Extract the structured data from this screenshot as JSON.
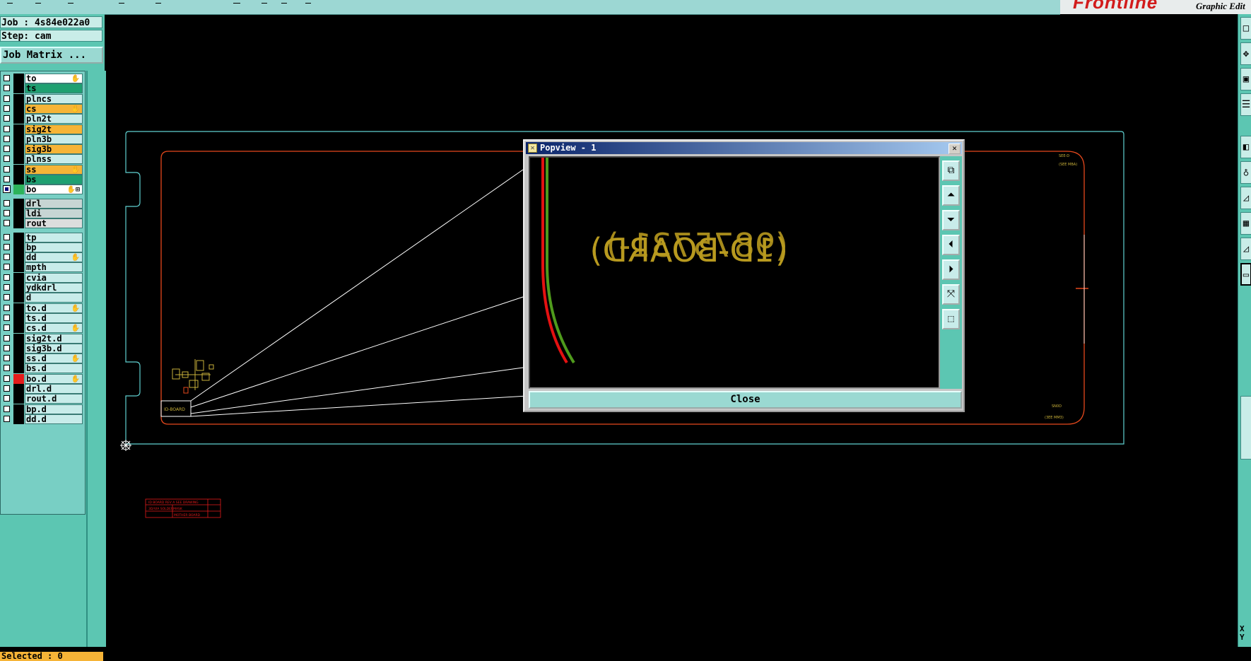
{
  "job": {
    "job_label": "Job : 4s84e022a0",
    "step_label": "Step: cam",
    "matrix_button": "Job Matrix ..."
  },
  "brand": {
    "logo": "Frontline",
    "subtitle": "Graphic Edit"
  },
  "layers": [
    {
      "name": "to",
      "color": "white",
      "checked": false,
      "mark": "✋"
    },
    {
      "name": "ts",
      "color": "green",
      "checked": false,
      "mark": ""
    },
    {
      "name": "plncs",
      "color": "cyan",
      "checked": false,
      "mark": ""
    },
    {
      "name": "cs",
      "color": "orange",
      "checked": false,
      "mark": "✋"
    },
    {
      "name": "pln2t",
      "color": "cyan",
      "checked": false,
      "mark": ""
    },
    {
      "name": "sig2t",
      "color": "orange",
      "checked": false,
      "mark": ""
    },
    {
      "name": "pln3b",
      "color": "cyan",
      "checked": false,
      "mark": ""
    },
    {
      "name": "sig3b",
      "color": "orange",
      "checked": false,
      "mark": ""
    },
    {
      "name": "plnss",
      "color": "cyan",
      "checked": false,
      "mark": ""
    },
    {
      "name": "ss",
      "color": "orange",
      "checked": false,
      "mark": "✋"
    },
    {
      "name": "bs",
      "color": "green",
      "checked": false,
      "mark": ""
    },
    {
      "name": "bo",
      "color": "white",
      "checked": true,
      "swatch": "#2db35a",
      "mark": "✋⊞"
    },
    {
      "name": "drl",
      "color": "gray",
      "checked": false,
      "mark": ""
    },
    {
      "name": "ldi",
      "color": "gray",
      "checked": false,
      "mark": ""
    },
    {
      "name": "rout",
      "color": "lgray",
      "checked": false,
      "mark": ""
    },
    {
      "name": "tp",
      "color": "cyan",
      "checked": false,
      "mark": ""
    },
    {
      "name": "bp",
      "color": "cyan",
      "checked": false,
      "mark": ""
    },
    {
      "name": "dd",
      "color": "cyan",
      "checked": false,
      "mark": "✋"
    },
    {
      "name": "mpth",
      "color": "cyan",
      "checked": false,
      "mark": ""
    },
    {
      "name": "cvia",
      "color": "cyan",
      "checked": false,
      "mark": ""
    },
    {
      "name": "ydkdrl",
      "color": "cyan",
      "checked": false,
      "mark": ""
    },
    {
      "name": "d",
      "color": "cyan",
      "checked": false,
      "mark": ""
    },
    {
      "name": "to.d",
      "color": "cyan",
      "checked": false,
      "mark": "✋"
    },
    {
      "name": "ts.d",
      "color": "cyan",
      "checked": false,
      "mark": ""
    },
    {
      "name": "cs.d",
      "color": "cyan",
      "checked": false,
      "mark": "✋"
    },
    {
      "name": "sig2t.d",
      "color": "cyan",
      "checked": false,
      "mark": ""
    },
    {
      "name": "sig3b.d",
      "color": "cyan",
      "checked": false,
      "mark": ""
    },
    {
      "name": "ss.d",
      "color": "cyan",
      "checked": false,
      "mark": "✋"
    },
    {
      "name": "bs.d",
      "color": "cyan",
      "checked": false,
      "mark": ""
    },
    {
      "name": "bo.d",
      "color": "cyan",
      "checked": false,
      "swatch": "#e41b1b",
      "mark": "✋"
    },
    {
      "name": "drl.d",
      "color": "cyan",
      "checked": false,
      "mark": ""
    },
    {
      "name": "rout.d",
      "color": "cyan",
      "checked": false,
      "mark": ""
    },
    {
      "name": "bp.d",
      "color": "cyan",
      "checked": false,
      "mark": ""
    },
    {
      "name": "dd.d",
      "color": "cyan",
      "checked": false,
      "mark": ""
    }
  ],
  "status": {
    "selected": "Selected : 0",
    "coord": "X\nY"
  },
  "popup": {
    "title": "Popview - 1",
    "close_button": "Close",
    "text_mirrored_a": "(1D-BOARD)",
    "text_mirrored_b": "(9875731-)",
    "side_icons": [
      "zoom-window-icon",
      "pan-up-icon",
      "pan-down-icon",
      "pan-left-icon",
      "pan-right-icon",
      "zoom-fit-icon",
      "zoom-home-icon"
    ]
  },
  "right_toolbar_icons": [
    "tool-1-icon",
    "tool-2-icon",
    "tool-3-icon",
    "tool-4-icon",
    "tool-5-icon",
    "tool-6-icon",
    "tool-7-icon",
    "tool-8-icon",
    "tool-9-icon",
    "tool-10-icon",
    "tool-11-icon"
  ],
  "colors": {
    "panel": "#5cc6b2",
    "board_outline": "#5fd0d0",
    "profile": "#e5481c",
    "text_yellow": "#b89a1f",
    "popup_trace_red": "#e41111",
    "popup_trace_green": "#4f9b1c"
  }
}
